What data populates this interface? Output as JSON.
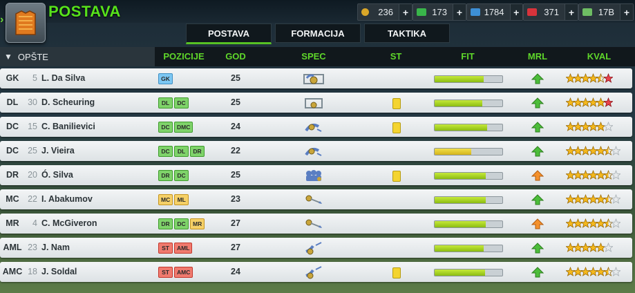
{
  "header": {
    "title": "POSTAVA",
    "resources": [
      {
        "icon": "coin-icon",
        "value": "236",
        "color": "#d9a628"
      },
      {
        "icon": "cash-icon",
        "value": "173",
        "color": "#39b54a"
      },
      {
        "icon": "energy-icon",
        "value": "1784",
        "color": "#3d8fd6"
      },
      {
        "icon": "medkit-icon",
        "value": "371",
        "color": "#d8333b"
      },
      {
        "icon": "money-icon",
        "value": "17B",
        "color": "#6ebd63"
      }
    ],
    "plus_label": "+"
  },
  "tabs": [
    {
      "label": "POSTAVA",
      "active": true
    },
    {
      "label": "FORMACIJA",
      "active": false
    },
    {
      "label": "TAKTIKA",
      "active": false
    }
  ],
  "columns": {
    "section": "OPŠTE",
    "pozicije": "POZICIJE",
    "god": "GOD",
    "spec": "SPEC",
    "st": "ST",
    "fit": "FIT",
    "mrl": "MRL",
    "kval": "KVAL"
  },
  "players": [
    {
      "pos": "GK",
      "num": "5",
      "name": "L. Da Silva",
      "positions": [
        "GK"
      ],
      "age": "25",
      "spec": "goalkeeper-icon",
      "card": false,
      "fit": 0.72,
      "morale": "up-icon",
      "stars": 4.5,
      "last_star": "red"
    },
    {
      "pos": "DL",
      "num": "30",
      "name": "D. Scheuring",
      "positions": [
        "DL",
        "DC"
      ],
      "age": "25",
      "spec": "goal-icon",
      "card": true,
      "fit": 0.7,
      "morale": "up-icon",
      "stars": 5,
      "last_star": "red"
    },
    {
      "pos": "DC",
      "num": "15",
      "name": "C. Banilievici",
      "positions": [
        "DC",
        "DMC"
      ],
      "age": "24",
      "spec": "tackle-icon",
      "card": true,
      "fit": 0.78,
      "morale": "up-icon",
      "stars": 5,
      "last_star": "empty"
    },
    {
      "pos": "DC",
      "num": "25",
      "name": "J. Vieira",
      "positions": [
        "DC",
        "DL",
        "DR"
      ],
      "age": "22",
      "spec": "tackle-icon",
      "card": false,
      "fit": 0.54,
      "morale": "up-icon",
      "stars": 5.5,
      "last_star": "empty"
    },
    {
      "pos": "DR",
      "num": "20",
      "name": "Ó. Silva",
      "positions": [
        "DR",
        "DC"
      ],
      "age": "25",
      "spec": "wall-icon",
      "card": true,
      "fit": 0.75,
      "morale": "neutral-icon",
      "stars": 5.5,
      "last_star": "empty"
    },
    {
      "pos": "MC",
      "num": "22",
      "name": "I. Abakumov",
      "positions": [
        "MC",
        "ML"
      ],
      "age": "23",
      "spec": "pass-icon",
      "card": false,
      "fit": 0.76,
      "morale": "up-icon",
      "stars": 5.5,
      "last_star": "empty"
    },
    {
      "pos": "MR",
      "num": "4",
      "name": "C. McGiveron",
      "positions": [
        "DR",
        "DC",
        "MR"
      ],
      "age": "27",
      "spec": "pass-icon",
      "card": false,
      "fit": 0.76,
      "morale": "neutral-icon",
      "stars": 5.5,
      "last_star": "empty"
    },
    {
      "pos": "AML",
      "num": "23",
      "name": "J. Nam",
      "positions": [
        "ST",
        "AML"
      ],
      "age": "27",
      "spec": "shot-icon",
      "card": false,
      "fit": 0.72,
      "morale": "up-icon",
      "stars": 5,
      "last_star": "empty"
    },
    {
      "pos": "AMC",
      "num": "18",
      "name": "J. Soldal",
      "positions": [
        "ST",
        "AMC"
      ],
      "age": "24",
      "spec": "shot-icon",
      "card": true,
      "fit": 0.74,
      "morale": "up-icon",
      "stars": 5.5,
      "last_star": "empty"
    }
  ]
}
